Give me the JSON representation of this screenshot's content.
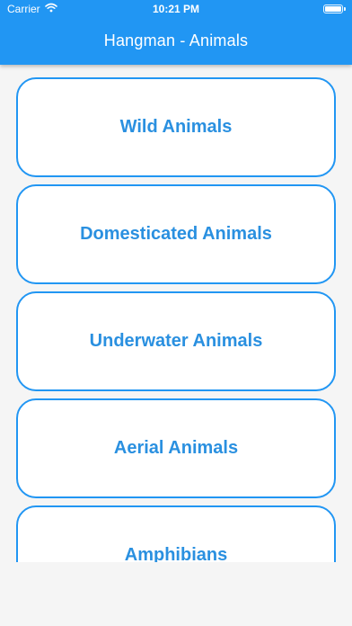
{
  "status_bar": {
    "carrier": "Carrier",
    "time": "10:21 PM"
  },
  "app_bar": {
    "title": "Hangman - Animals",
    "color": "#2196f3"
  },
  "categories": [
    {
      "label": "Wild Animals"
    },
    {
      "label": "Domesticated Animals"
    },
    {
      "label": "Underwater Animals"
    },
    {
      "label": "Aerial Animals"
    },
    {
      "label": "Amphibians"
    }
  ],
  "colors": {
    "accent": "#2196f3",
    "card_text": "#2a90e0",
    "background": "#f5f5f5"
  }
}
